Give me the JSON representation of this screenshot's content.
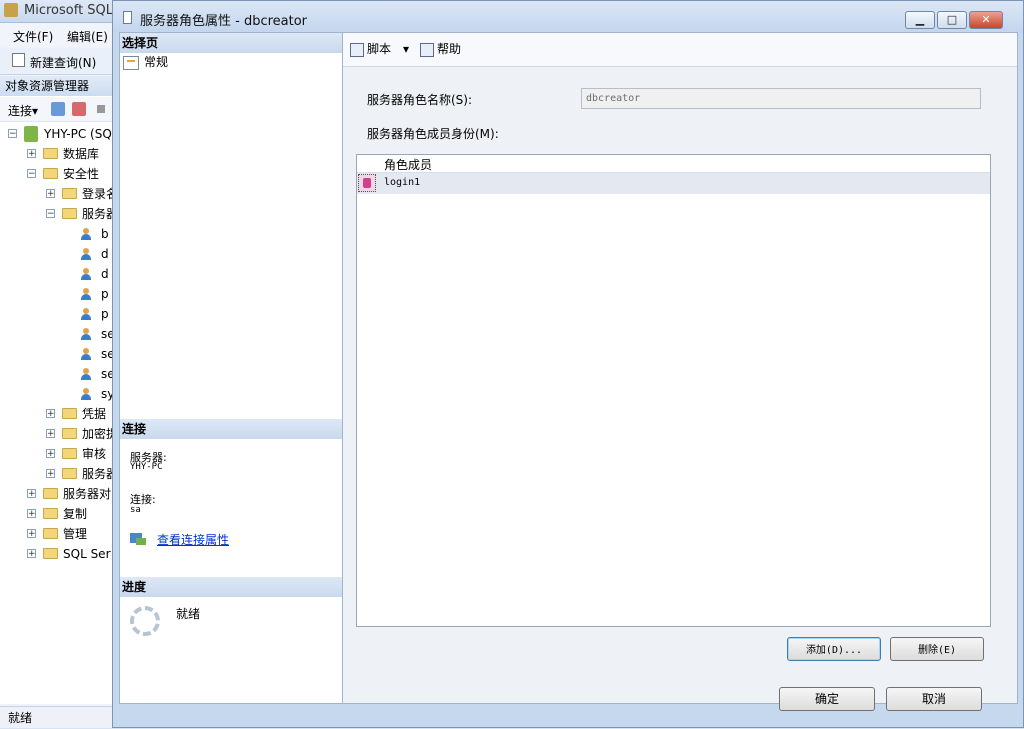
{
  "background_app": {
    "title": "Microsoft SQL",
    "menu": [
      "文件(F)",
      "编辑(E)"
    ],
    "toolbar_new_query": "新建查询(N)",
    "object_explorer_title": "对象资源管理器",
    "connect_label": "连接",
    "tree": [
      {
        "label": "YHY-PC (SQ",
        "level": 0,
        "expander": "−"
      },
      {
        "label": "数据库",
        "level": 1,
        "expander": "+"
      },
      {
        "label": "安全性",
        "level": 1,
        "expander": "−"
      },
      {
        "label": "登录名",
        "level": 2,
        "expander": "+"
      },
      {
        "label": "服务器",
        "level": 2,
        "expander": "−"
      },
      {
        "label": "b",
        "level": 3
      },
      {
        "label": "d",
        "level": 3
      },
      {
        "label": "d",
        "level": 3
      },
      {
        "label": "p",
        "level": 3
      },
      {
        "label": "p",
        "level": 3
      },
      {
        "label": "se",
        "level": 3
      },
      {
        "label": "se",
        "level": 3
      },
      {
        "label": "se",
        "level": 3
      },
      {
        "label": "sy",
        "level": 3
      },
      {
        "label": "凭据",
        "level": 2,
        "expander": "+"
      },
      {
        "label": "加密提",
        "level": 2,
        "expander": "+"
      },
      {
        "label": "审核",
        "level": 2,
        "expander": "+"
      },
      {
        "label": "服务器",
        "level": 2,
        "expander": "+"
      },
      {
        "label": "服务器对",
        "level": 1,
        "expander": "+"
      },
      {
        "label": "复制",
        "level": 1,
        "expander": "+"
      },
      {
        "label": "管理",
        "level": 1,
        "expander": "+"
      },
      {
        "label": "SQL Ser",
        "level": 1,
        "expander": "+"
      }
    ],
    "status": "就绪"
  },
  "dialog": {
    "title": "服务器角色属性 - dbcreator",
    "window_buttons": {
      "minimize": "▁",
      "maximize": "□",
      "close": "✕"
    },
    "left": {
      "select_page_header": "选择页",
      "pages": [
        "常规"
      ],
      "connection_header": "连接",
      "server_label": "服务器:",
      "server_value": "YHY-PC",
      "connection_label": "连接:",
      "connection_value": "sa",
      "view_connection_link": "查看连接属性",
      "progress_header": "进度",
      "progress_status": "就绪"
    },
    "toolbar": {
      "script_label": "脚本",
      "help_label": "帮助"
    },
    "form": {
      "role_name_label": "服务器角色名称(S):",
      "role_name_value": "dbcreator",
      "role_members_label": "服务器角色成员身份(M):",
      "grid_header": "角色成员",
      "members": [
        "login1"
      ]
    },
    "buttons": {
      "add": "添加(D)...",
      "remove": "删除(E)",
      "ok": "确定",
      "cancel": "取消"
    }
  }
}
